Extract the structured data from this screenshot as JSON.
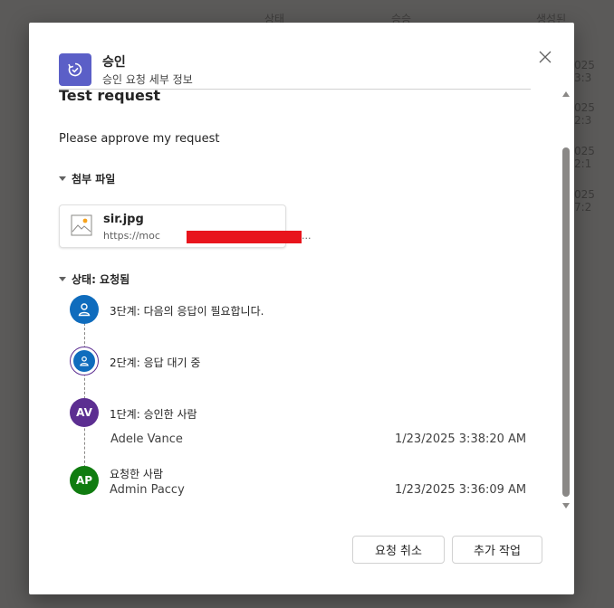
{
  "background": {
    "headers": [
      "상태",
      "승승",
      "생성된"
    ],
    "dates": [
      "025 3:3",
      "025 2:3",
      "025 2:1",
      "025 7:2"
    ]
  },
  "dialog": {
    "app_title": "승인",
    "app_subtitle": "승인 요청 세부 정보",
    "close_icon": "close-icon",
    "request_title": "Test request",
    "request_description": "Please approve my request",
    "attachments_header": "첨부 파일",
    "attachment": {
      "name": "sir.jpg",
      "url_prefix": "https://moc",
      "url_suffix": "...",
      "icon": "image-file-icon"
    },
    "status_header": "상태: 요청됨",
    "steps": [
      {
        "label": "3단계: 다음의 응답이 필요합니다.",
        "avatar": "person-icon",
        "color": "#0f6cbd"
      },
      {
        "label": "2단계: 응답 대기 중",
        "avatar": "person-icon",
        "color": "#0f6cbd"
      },
      {
        "label": "1단계: 승인한 사람",
        "initials": "AV",
        "color": "#5c2e91",
        "person": "Adele Vance",
        "timestamp": "1/23/2025 3:38:20 AM"
      },
      {
        "label": "요청한 사람",
        "initials": "AP",
        "color": "#107c10",
        "person": "Admin Paccy",
        "timestamp": "1/23/2025 3:36:09 AM"
      }
    ],
    "buttons": {
      "cancel_request": "요청 취소",
      "more_actions": "추가 작업"
    },
    "accent_color": "#5b5fc7"
  }
}
